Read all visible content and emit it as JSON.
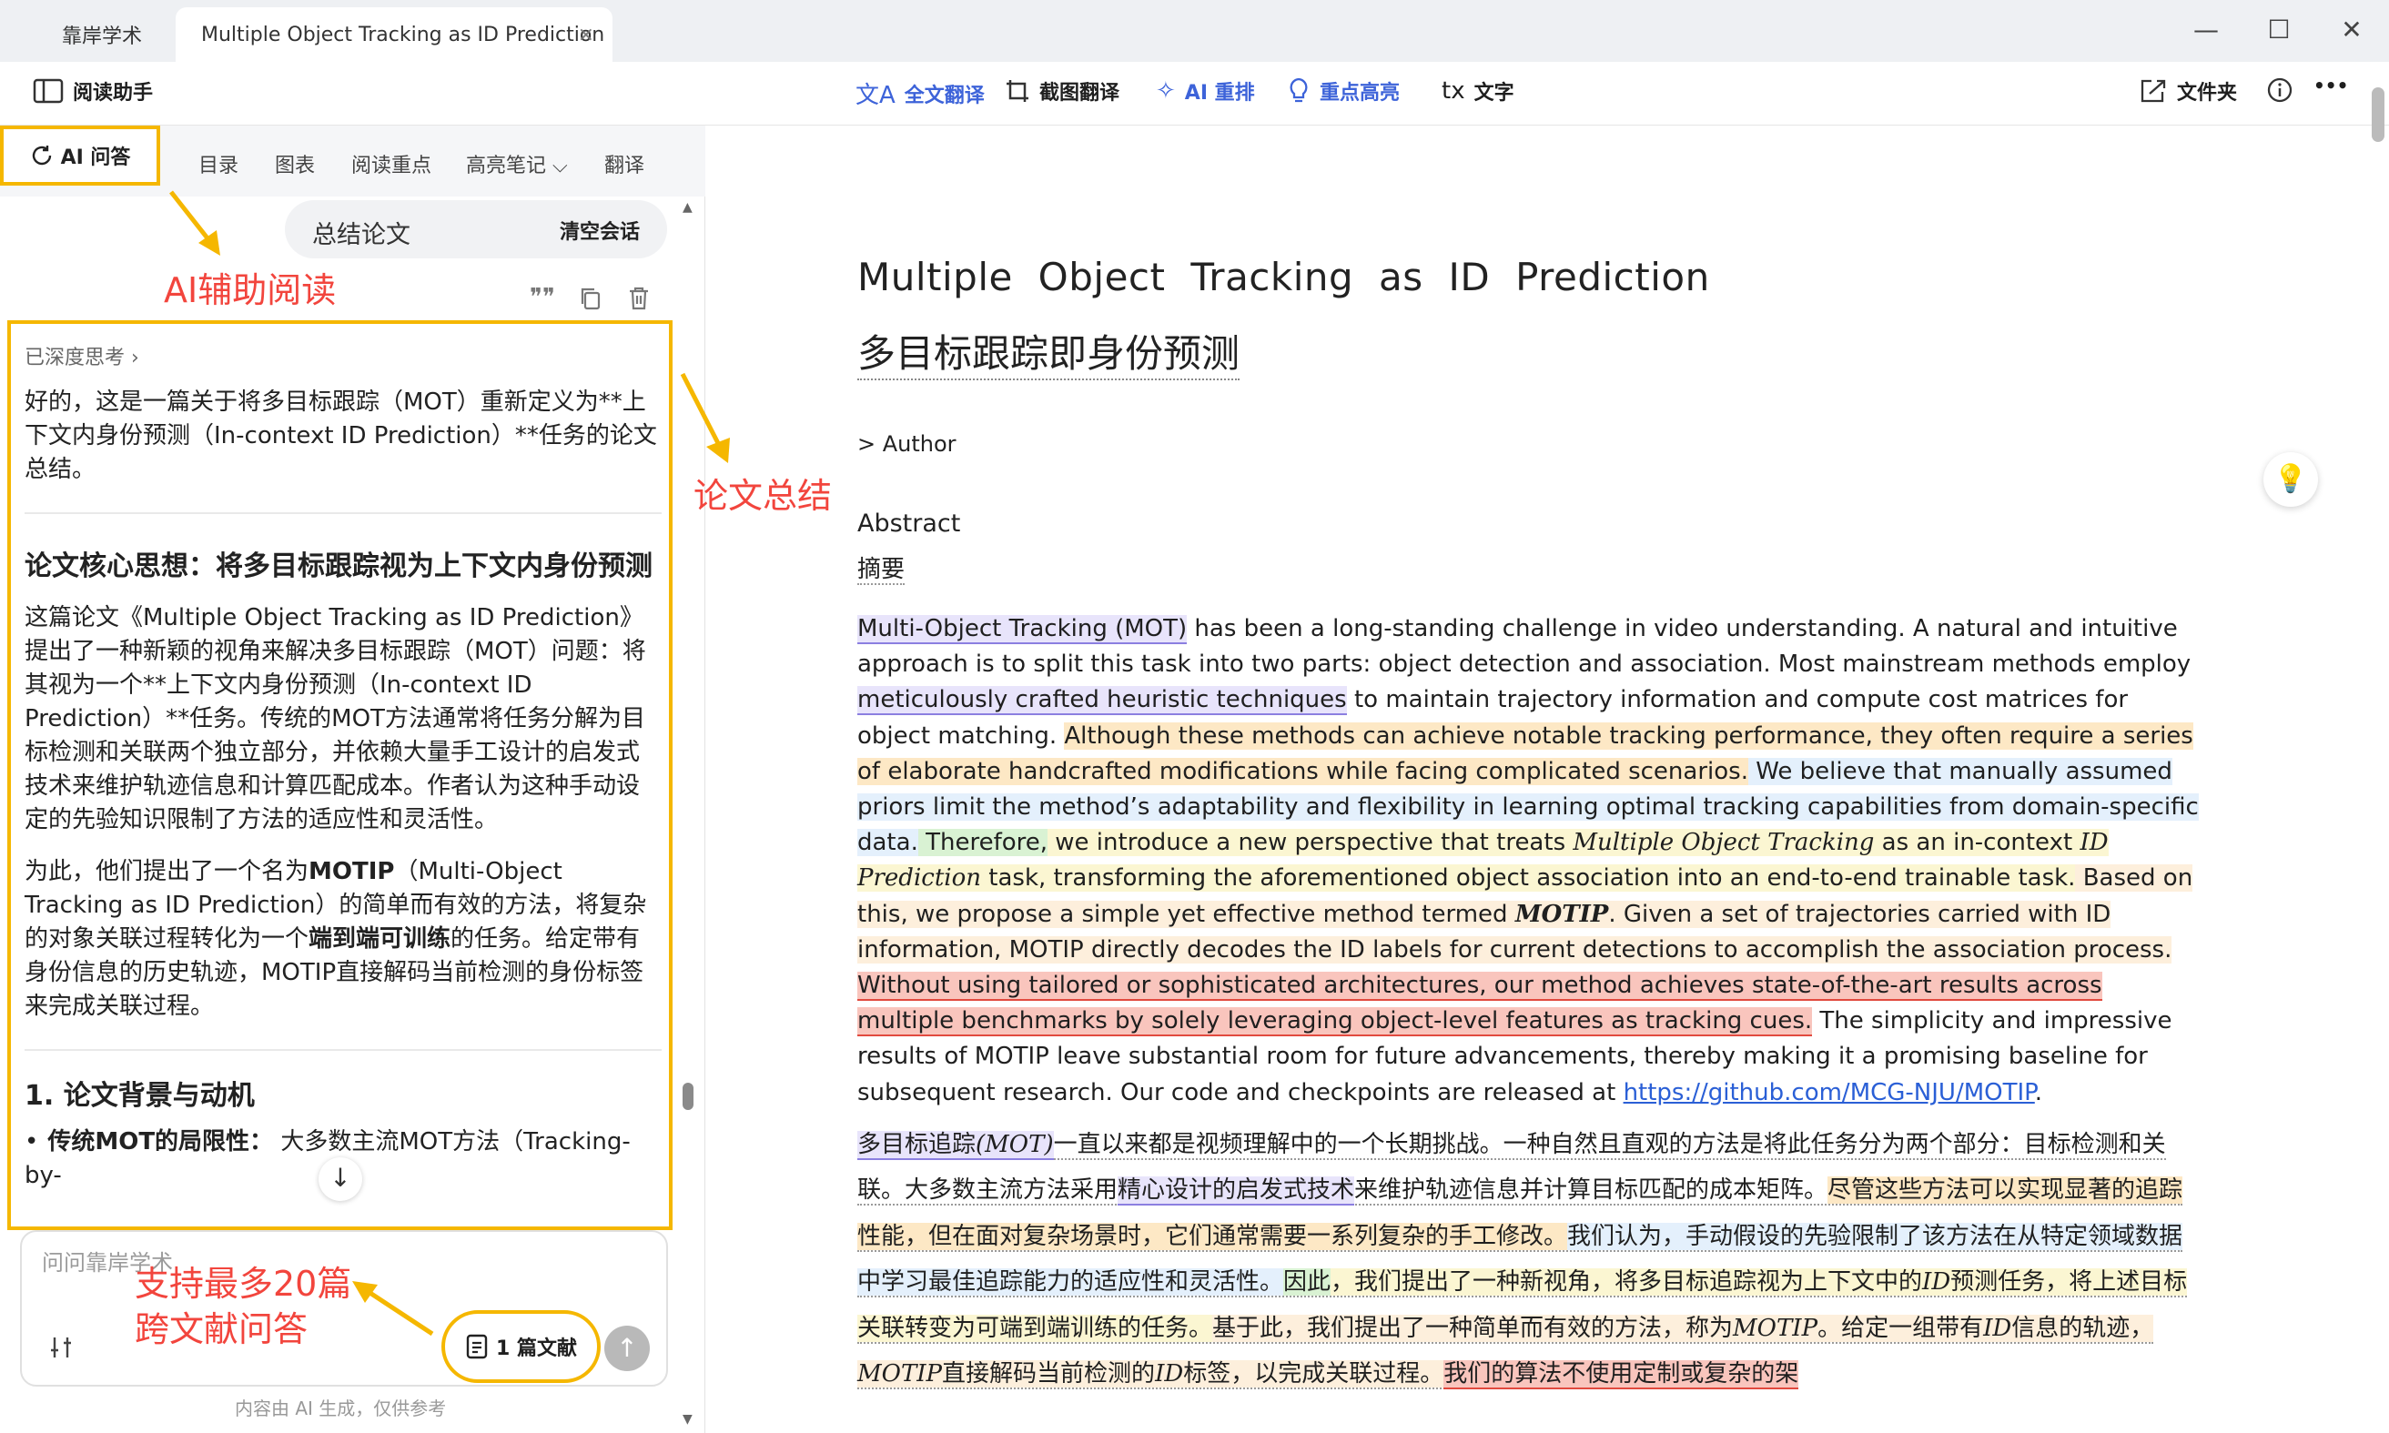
{
  "window": {
    "tabs": [
      {
        "label": "靠岸学术"
      },
      {
        "label": "Multiple Object Tracking as ID Prediction"
      }
    ],
    "close_glyph": "×",
    "controls": {
      "minimize": "—",
      "maximize": "☐",
      "close": "✕"
    }
  },
  "toolbar": {
    "reading_assistant": "阅读助手",
    "full_translate": "全文翻译",
    "screenshot_translate": "截图翻译",
    "ai_rearrange": "AI 重排",
    "highlight": "重点高亮",
    "text_prefix": "tx",
    "text": "文字",
    "folder": "文件夹",
    "more": "•••",
    "accent_color": "#3d63d9"
  },
  "left_tabs": {
    "ai_qa": "AI 问答",
    "toc": "目录",
    "figures": "图表",
    "key_points": "阅读重点",
    "highlight_notes": "高亮笔记",
    "translate": "翻译"
  },
  "chat": {
    "summary_chip": "总结论文",
    "clear_button": "清空会话",
    "deep_think": "已深度思考",
    "intro": "好的，这是一篇关于将多目标跟踪（MOT）重新定义为**上下文内身份预测（In-context ID Prediction）**任务的论文总结。",
    "heading1": "论文核心思想：将多目标跟踪视为上下文内身份预测",
    "para1": "这篇论文《Multiple Object Tracking as ID Prediction》提出了一种新颖的视角来解决多目标跟踪（MOT）问题：将其视为一个**上下文内身份预测（In-context ID Prediction）**任务。传统的MOT方法通常将任务分解为目标检测和关联两个独立部分，并依赖大量手工设计的启发式技术来维护轨迹信息和计算匹配成本。作者认为这种手动设定的先验知识限制了方法的适应性和灵活性。",
    "para2_a": "为此，他们提出了一个名为",
    "para2_motip": "MOTIP",
    "para2_b": "（Multi-Object Tracking as ID Prediction）的简单而有效的方法，将复杂的对象关联过程转化为一个",
    "para2_e2e": "端到端可训练",
    "para2_c": "的任务。给定带有身份信息的历史轨迹，MOTIP直接解码当前检测的身份标签来完成关联过程。",
    "heading2": "1. 论文背景与动机",
    "bullet_bold": "传统MOT的局限性：",
    "bullet_text": "大多数主流MOT方法（Tracking-by-",
    "input_placeholder": "问问靠岸学术",
    "doc_button": "1 篇文献",
    "disclaimer": "内容由 AI 生成，仅供参考"
  },
  "annotations": {
    "ai_reading": "AI辅助阅读",
    "summary": "论文总结",
    "multi_doc_line1": "支持最多20篇",
    "multi_doc_line2": "跨文献问答",
    "color": "#f2453d",
    "box_color": "#f5b700"
  },
  "document": {
    "title": "Multiple Object Tracking as ID Prediction",
    "title_cn": "多目标跟踪即身份预测",
    "author_toggle": ">  Author",
    "abstract_label": "Abstract",
    "abstract_label_cn": "摘要",
    "en": {
      "s1": "Multi-Object Tracking (MOT)",
      "s2": " has been a long-standing challenge in video understanding. A natural and intuitive approach is to split this task into two parts: object detection and association. Most mainstream methods employ ",
      "s3": "meticulously crafted heuristic techniques",
      "s4": " to maintain trajectory information and compute cost matrices for object matching. ",
      "s5": "Although these methods can achieve notable tracking performance, they often require a series of elaborate handcrafted modifications while facing complicated scenarios.",
      "s6": " We believe that manually assumed priors limit the method’s adaptability and flexibility in learning optimal tracking capabilities from domain-specific data.",
      "s7": " Therefore,",
      "s8": " we introduce a new perspective that treats ",
      "s9": "Multiple Object Tracking",
      "s10": " as an in-context ",
      "s11": "ID Prediction",
      "s12": " task, transforming the aforementioned object association into an end-to-end trainable task.",
      "s13": " Based on this, we propose a simple yet effective method termed ",
      "s14": "MOTIP",
      "s15": ". Given a set of trajectories carried with ID information, MOTIP directly decodes the ID labels for current detections to accomplish the association process. ",
      "s16": "Without using tailored or sophisticated architectures, our method achieves ",
      "s17": "state-of-the-art",
      "s18": " ",
      "s19": "results",
      "s20": " across multiple benchmarks by solely leveraging object-level features as ",
      "s21": "tracking cues.",
      "s22": " The simplicity and impressive results of MOTIP leave substantial room for future advancements, thereby making it a promising baseline for subsequent research. Our code and checkpoints are released at ",
      "link": "https://github.com/MCG-NJU/MOTIP",
      "s23": "."
    },
    "cn": {
      "c1": "多目标追踪",
      "c1b": "(MOT)",
      "c2": "一直以来都是视频理解中的一个长期挑战。一种自然且直观的方法是将此任务分为两个部分：目标检测和关联。大多数主流方法采用",
      "c3": "精心设计的启发式技术",
      "c4": "来维护轨迹信息并计算目标匹配的成本矩阵。",
      "c5": "尽管这些方法可以实现显著的追踪性能，但在面对复杂场景时，它们通常需要一系列复杂的手工修改。",
      "c6": "我们认为，手动假设的先验限制了该方法在从特定领域数据中学习最佳追踪能力的适应性和灵活性。",
      "c7": "因此",
      "c8": "，我们提出了一种新视角，将多目标追踪视为上下文中的",
      "c9": "ID",
      "c10": "预测任务，将上述目标关联转变为可端到端训练的任务。",
      "c11": "基于此，我们提出了一种简单而有效的方法，称为",
      "c12": "MOTIP",
      "c13": "。给定一组带有",
      "c14": "ID",
      "c15": "信息的轨迹，",
      "c16": "MOTIP",
      "c17": "直接解码当前检测的",
      "c18": "ID",
      "c19": "标签，以完成关联过程。",
      "c20": "我们的算法不使用定制或复杂的架"
    }
  }
}
